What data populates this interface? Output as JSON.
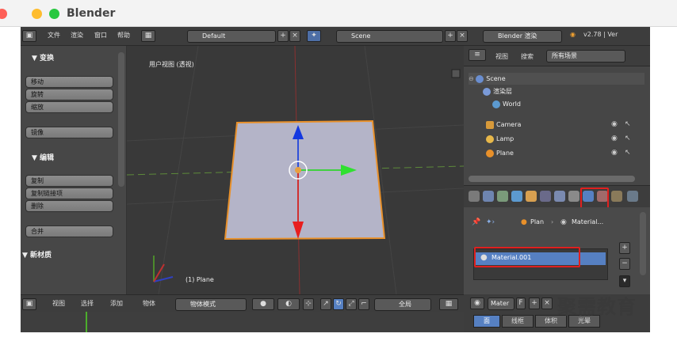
{
  "app": {
    "title": "Blender"
  },
  "menu": {
    "file": "文件",
    "render": "渲染",
    "window": "窗口",
    "help": "帮助"
  },
  "layout": {
    "value": "Default"
  },
  "scene": {
    "value": "Scene"
  },
  "engine": {
    "value": "Blender 渲染"
  },
  "version": {
    "text": "v2.78 | Ver"
  },
  "tool_shelf": {
    "transform_header": "▼ 变换",
    "transform_buttons": [
      "移动",
      "旋转",
      "缩放"
    ],
    "mirror": "镜像",
    "edit_header": "▼ 编辑",
    "edit_buttons": [
      "复制",
      "复制链接项",
      "删除"
    ],
    "join": "合并",
    "new_material": "▼ 新材质"
  },
  "viewport": {
    "label": "用户视图 (透视)",
    "object": "(1) Plane"
  },
  "bottom_bar": {
    "view": "视图",
    "select": "选择",
    "add": "添加",
    "object": "物体",
    "mode": "物体模式",
    "global": "全局"
  },
  "outliner": {
    "view": "视图",
    "search": "搜索",
    "filter": "所有场景",
    "items": [
      {
        "name": "Scene"
      },
      {
        "name": "渲染层"
      },
      {
        "name": "World"
      },
      {
        "name": "Camera"
      },
      {
        "name": "Lamp"
      },
      {
        "name": "Plane"
      }
    ]
  },
  "properties": {
    "breadcrumb_object": "Plan",
    "breadcrumb_material": "Material...",
    "material_slot": "Material.001",
    "material_field": "Mater",
    "f_label": "F",
    "bottom_tabs": [
      "面",
      "线框",
      "体积",
      "光晕"
    ]
  },
  "watermark": {
    "text": "聚需教育"
  },
  "colors": {
    "highlight": "#e0201f",
    "selection": "#5680c2",
    "plane": "#b4b4c8",
    "plane_edge": "#e8902a"
  }
}
